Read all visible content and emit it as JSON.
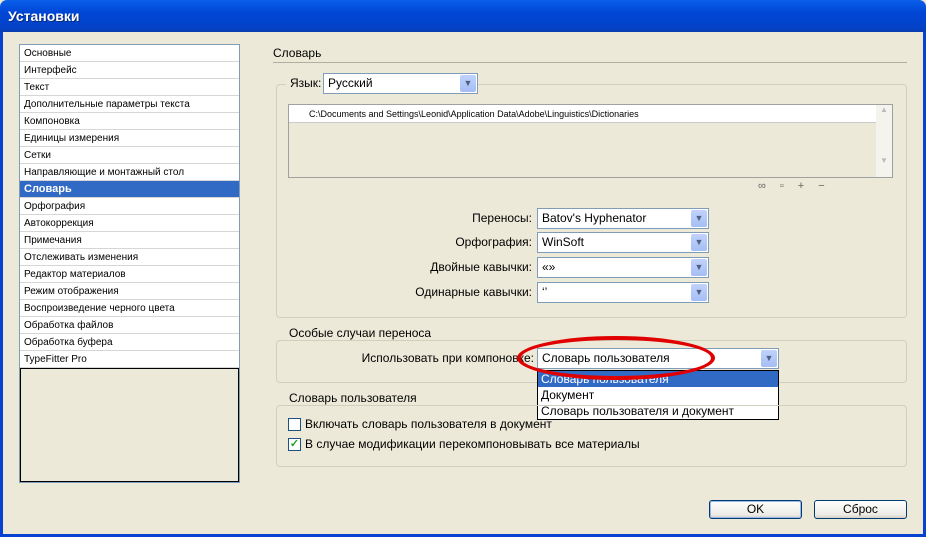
{
  "window": {
    "title": "Установки"
  },
  "sidebar": {
    "items": [
      "Основные",
      "Интерфейс",
      "Текст",
      "Дополнительные параметры текста",
      "Компоновка",
      "Единицы измерения",
      "Сетки",
      "Направляющие и монтажный стол",
      "Словарь",
      "Орфография",
      "Автокоррекция",
      "Примечания",
      "Отслеживать изменения",
      "Редактор материалов",
      "Режим отображения",
      "Воспроизведение черного цвета",
      "Обработка файлов",
      "Обработка буфера",
      "TypeFitter Pro"
    ],
    "selected": "Словарь"
  },
  "section": {
    "title": "Словарь"
  },
  "language": {
    "label": "Язык:",
    "value": "Русский"
  },
  "paths": [
    "C:\\Documents and Settings\\Leonid\\Application Data\\Adobe\\Linguistics\\Dictionaries"
  ],
  "path_icons": [
    "relink-icon",
    "new-list-icon",
    "add-icon",
    "remove-icon"
  ],
  "fields": [
    {
      "label": "Переносы:",
      "value": "Batov's Hyphenator"
    },
    {
      "label": "Орфография:",
      "value": "WinSoft"
    },
    {
      "label": "Двойные кавычки:",
      "value": "«»"
    },
    {
      "label": "Одинарные кавычки:",
      "value": "‘’"
    }
  ],
  "hyphen_exceptions": {
    "title": "Особые случаи переноса",
    "label": "Использовать при компоновке:",
    "value": "Словарь пользователя",
    "options": [
      "Словарь пользователя",
      "Документ",
      "Словарь пользователя и документ"
    ],
    "highlighted": "Словарь пользователя"
  },
  "user_dict": {
    "title": "Словарь пользователя",
    "checkboxes": [
      {
        "label": "Включать словарь пользователя в документ",
        "checked": false
      },
      {
        "label": "В случае модификации перекомпоновывать все материалы",
        "checked": true
      }
    ]
  },
  "buttons": {
    "ok": "OK",
    "reset": "Сброс"
  },
  "colors": {
    "selection": "#316AC5",
    "annotation": "#E00000",
    "titlebar": "#0046D5"
  }
}
